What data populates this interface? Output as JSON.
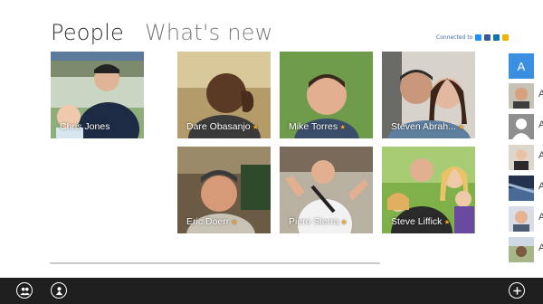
{
  "header": {
    "people": "People",
    "whats_new": "What's new",
    "connected_to": "Connected to"
  },
  "services": [
    {
      "icon": "windows-live-icon",
      "color": "#1e90ff"
    },
    {
      "icon": "facebook-icon",
      "color": "#3b5998"
    },
    {
      "icon": "linkedin-icon",
      "color": "#0e76a8"
    },
    {
      "icon": "messenger-icon",
      "color": "#f0b400"
    }
  ],
  "me": {
    "name": "Chris Jones"
  },
  "favorites": [
    {
      "name": "Dare Obasanjo",
      "star": "★"
    },
    {
      "name": "Mike Torres",
      "star": "★"
    },
    {
      "name": "Steven Abrah...",
      "star": "★"
    },
    {
      "name": "Eric Doerr",
      "star": "★"
    },
    {
      "name": "Piero Sierra",
      "star": "★"
    },
    {
      "name": "Steve Liffick",
      "star": "★"
    }
  ],
  "rail": {
    "letter": "A",
    "cut_letter": "A"
  },
  "appbar": {
    "left": [
      "people-icon",
      "me-icon"
    ],
    "right": [
      "add-icon"
    ]
  }
}
